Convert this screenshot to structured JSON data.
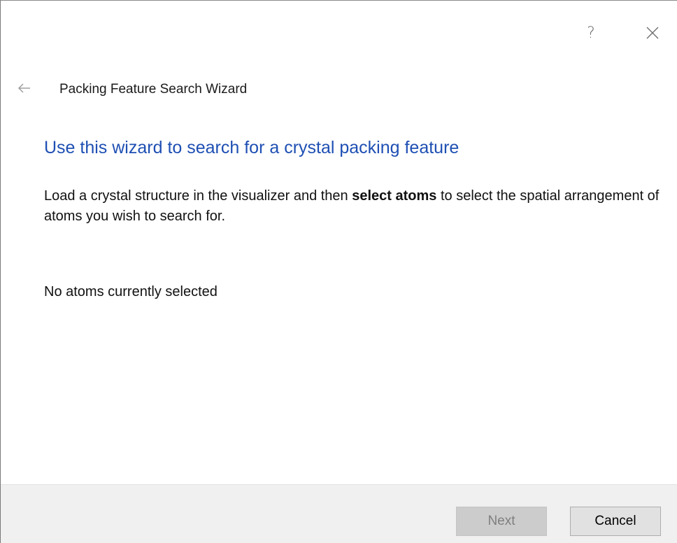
{
  "window": {
    "help_label": "?",
    "help_icon": "question-mark-icon",
    "close_icon": "close-icon"
  },
  "header": {
    "back_icon": "back-arrow-icon",
    "title": "Packing Feature Search Wizard"
  },
  "main": {
    "heading": "Use this wizard to search for a crystal packing feature",
    "description_before": "Load a crystal structure in the visualizer and then ",
    "description_bold": "select atoms",
    "description_after": " to select the spatial arrangement of atoms you wish to search for.",
    "selection_status": "No atoms currently selected"
  },
  "footer": {
    "next_label": "Next",
    "next_enabled": false,
    "cancel_label": "Cancel"
  },
  "colors": {
    "heading": "#1e4fb3",
    "footer_bg": "#f0f0f0",
    "disabled_button": "#cccccc",
    "button": "#e1e1e1"
  }
}
